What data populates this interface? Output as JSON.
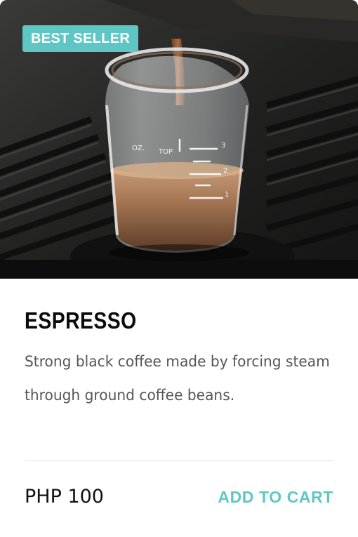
{
  "product": {
    "badge": "BEST SELLER",
    "name": "ESPRESSO",
    "description": "Strong black coffee made by forcing steam through ground coffee beans.",
    "price": "PHP 100",
    "action_label": "ADD TO CART",
    "image_icon": "espresso-shot-photo"
  },
  "colors": {
    "accent": "#5fc6c6",
    "title": "#0c0c0c",
    "text": "#555555",
    "divider": "#e2e2e2"
  }
}
